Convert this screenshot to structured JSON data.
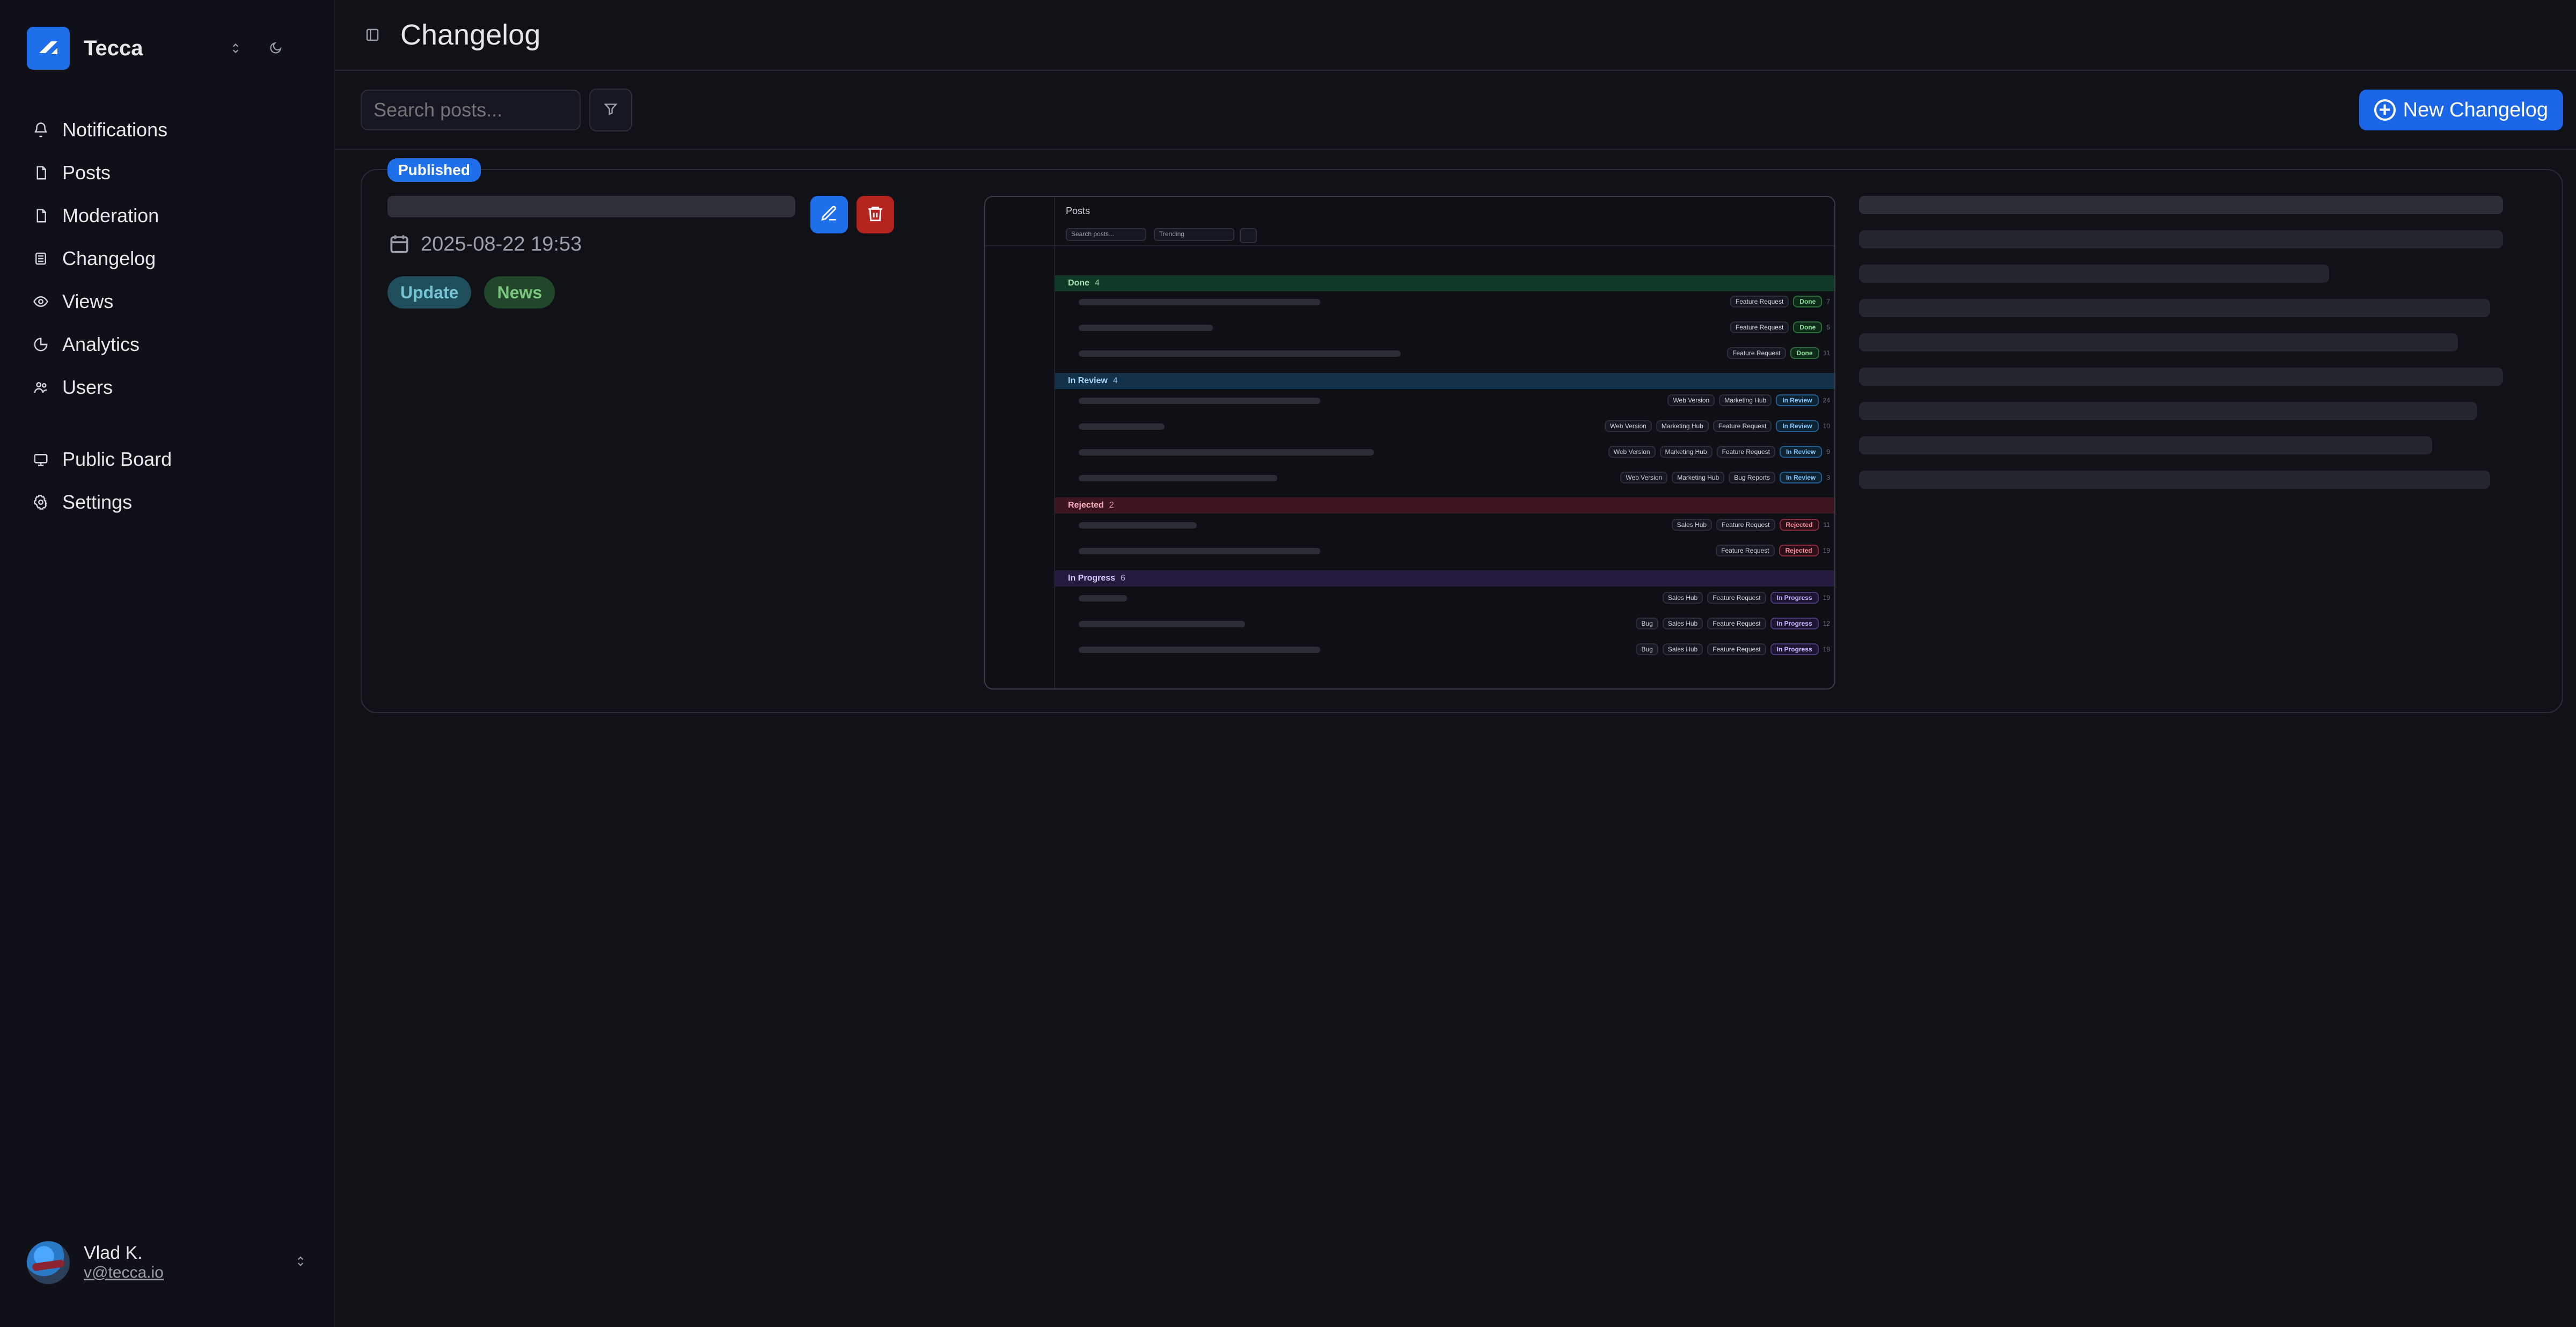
{
  "app": {
    "name": "Tecca",
    "accent": "#1f6feb"
  },
  "sidebar": {
    "items": [
      {
        "label": "Notifications",
        "icon": "bell-icon"
      },
      {
        "label": "Posts",
        "icon": "post-icon"
      },
      {
        "label": "Moderation",
        "icon": "document-icon"
      },
      {
        "label": "Changelog",
        "icon": "changelog-icon"
      },
      {
        "label": "Views",
        "icon": "views-icon"
      },
      {
        "label": "Analytics",
        "icon": "analytics-icon"
      },
      {
        "label": "Users",
        "icon": "users-icon"
      }
    ],
    "secondary": [
      {
        "label": "Public Board",
        "icon": "board-icon"
      },
      {
        "label": "Settings",
        "icon": "gear-icon"
      }
    ]
  },
  "user": {
    "name": "Vlad K.",
    "email": "v@tecca.io"
  },
  "header": {
    "title": "Changelog"
  },
  "toolbar": {
    "search_placeholder": "Search posts...",
    "new_button": "New Changelog"
  },
  "changelog_card": {
    "status": "Published",
    "date": "2025-08-22 19:53",
    "tags": [
      "Update",
      "News"
    ]
  },
  "preview": {
    "title": "Posts",
    "search_placeholder": "Search posts...",
    "sort": "Trending",
    "groups": [
      {
        "name": "Done",
        "count": "4"
      },
      {
        "name": "In Review",
        "count": "4"
      },
      {
        "name": "Rejected",
        "count": "2"
      },
      {
        "name": "In Progress",
        "count": "6"
      }
    ],
    "rows": [
      {
        "group": "Done",
        "chips": [
          "Feature Request"
        ],
        "status": "Done",
        "num": "7"
      },
      {
        "group": "Done",
        "chips": [
          "Feature Request"
        ],
        "status": "Done",
        "num": "5"
      },
      {
        "group": "Done",
        "chips": [
          "Feature Request"
        ],
        "status": "Done",
        "num": "11"
      },
      {
        "group": "In Review",
        "chips": [
          "Web Version",
          "Marketing Hub"
        ],
        "status": "In Review",
        "num": "24"
      },
      {
        "group": "In Review",
        "chips": [
          "Web Version",
          "Marketing Hub",
          "Feature Request"
        ],
        "status": "In Review",
        "num": "10"
      },
      {
        "group": "In Review",
        "chips": [
          "Web Version",
          "Marketing Hub",
          "Feature Request"
        ],
        "status": "In Review",
        "num": "9"
      },
      {
        "group": "In Review",
        "chips": [
          "Web Version",
          "Marketing Hub",
          "Bug Reports"
        ],
        "status": "In Review",
        "num": "3"
      },
      {
        "group": "Rejected",
        "chips": [
          "Sales Hub",
          "Feature Request"
        ],
        "status": "Rejected",
        "num": "11"
      },
      {
        "group": "Rejected",
        "chips": [
          "Feature Request"
        ],
        "status": "Rejected",
        "num": "19"
      },
      {
        "group": "In Progress",
        "chips": [
          "Sales Hub",
          "Feature Request"
        ],
        "status": "In Progress",
        "num": "19"
      },
      {
        "group": "In Progress",
        "chips": [
          "Bug",
          "Sales Hub",
          "Feature Request"
        ],
        "status": "In Progress",
        "num": "12"
      },
      {
        "group": "In Progress",
        "chips": [
          "Bug",
          "Sales Hub",
          "Feature Request"
        ],
        "status": "In Progress",
        "num": "18"
      }
    ]
  }
}
